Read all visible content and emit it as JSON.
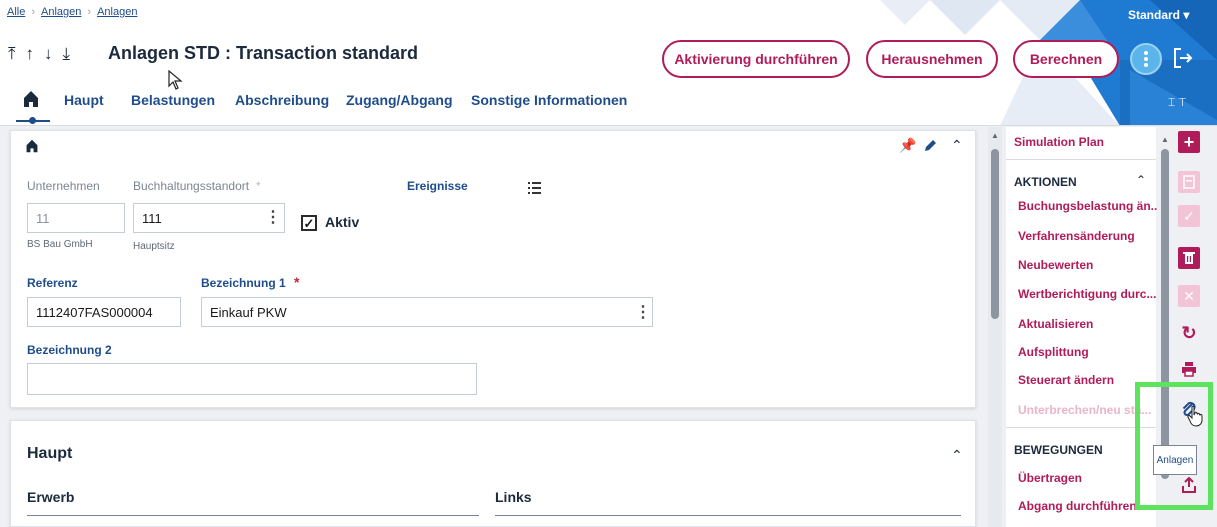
{
  "breadcrumb": [
    "Alle",
    "Anlagen",
    "Anlagen"
  ],
  "title": "Anlagen STD : Transaction standard",
  "header_buttons": {
    "activate": "Aktivierung durchführen",
    "remove": "Herausnehmen",
    "calculate": "Berechnen"
  },
  "standard_menu": "Standard ▾",
  "tabs": [
    "Haupt",
    "Belastungen",
    "Abschreibung",
    "Zugang/Abgang",
    "Sonstige Informationen"
  ],
  "form": {
    "unternehmen_label": "Unternehmen",
    "unternehmen_value": "11",
    "unternehmen_desc": "BS Bau GmbH",
    "standort_label": "Buchhaltungsstandort",
    "standort_value": "111",
    "standort_desc": "Hauptsitz",
    "aktiv_label": "Aktiv",
    "ereignisse_label": "Ereignisse",
    "referenz_label": "Referenz",
    "referenz_value": "1112407FAS000004",
    "bez1_label": "Bezeichnung 1",
    "bez1_value": "Einkauf PKW",
    "bez2_label": "Bezeichnung 2",
    "bez2_value": "",
    "required_mark": "*"
  },
  "section": {
    "title": "Haupt",
    "col1": "Erwerb",
    "col2": "Links"
  },
  "right_panel": {
    "simulation": "Simulation Plan",
    "aktionen_title": "AKTIONEN",
    "aktionen": [
      "Buchungsbelastung än...",
      "Verfahrensänderung",
      "Neubewerten",
      "Wertberichtigung durc...",
      "Aktualisieren",
      "Aufsplittung",
      "Steuerart ändern"
    ],
    "aktionen_disabled": "Unterbrechen/neu sta...",
    "bewegungen_title": "BEWEGUNGEN",
    "bewegungen": [
      "Übertragen",
      "Abgang durchführen"
    ]
  },
  "tooltip": "Anlagen",
  "colors": {
    "accent": "#b01c5a",
    "primary_text": "#1f4d8c",
    "header_deco": "#1f7ad1",
    "highlight": "#5ee35e"
  }
}
